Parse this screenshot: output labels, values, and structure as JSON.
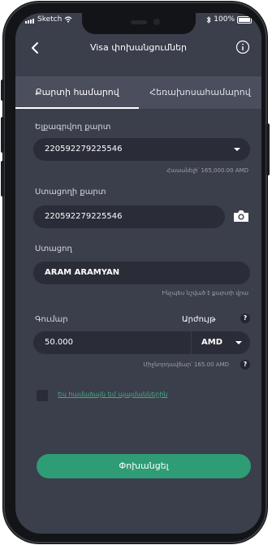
{
  "status": {
    "carrier": "Sketch",
    "battery": "100%"
  },
  "header": {
    "title": "Visa փոխանցումներ"
  },
  "tabs": [
    {
      "label": "Քարտի համարով"
    },
    {
      "label": "Հեռախոսահամարով"
    }
  ],
  "form": {
    "sender_card": {
      "label": "Ելքագրվող քարտ",
      "value": "220592279225546",
      "hint": "Հասանելի՝ 165,000.00 AMD"
    },
    "recipient_card": {
      "label": "Ստացողի քարտ",
      "value": "220592279225546"
    },
    "recipient": {
      "label": "Ստացող",
      "value": "ARAM ARAMYAN",
      "hint": "Ինչպես նշված է քարտի վրա"
    },
    "amount": {
      "label": "Գումար",
      "value": "50.000",
      "currency_label": "Արժույթ",
      "currency": "AMD",
      "fee_hint": "Միջնորդավճար՝ 165.00 AMD"
    },
    "terms_text": "Ես համաձայն եմ պայմաններին"
  },
  "submit_label": "Փոխանցել",
  "colors": {
    "screen_bg": "#3b3e4b",
    "field_bg": "#2a2c37",
    "accent_green": "#2e9c74",
    "link_green": "#3fae83"
  }
}
